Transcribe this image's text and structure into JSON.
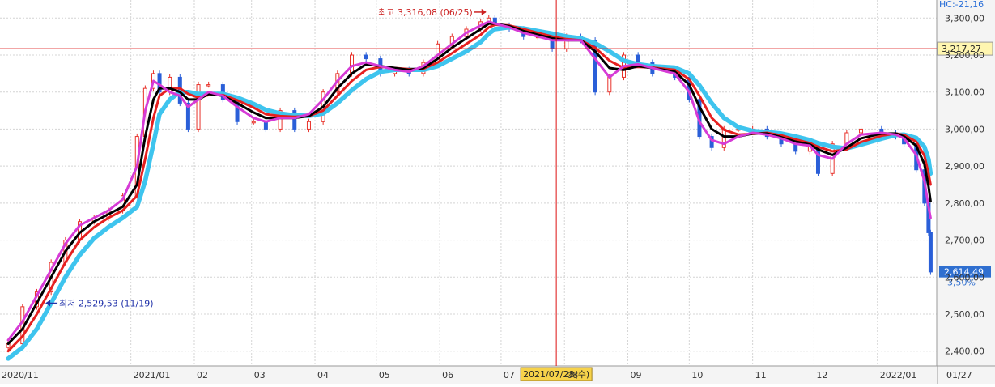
{
  "chart_data": {
    "type": "line",
    "ylim": [
      2360,
      3340
    ],
    "y_ticks": [
      2400,
      2500,
      2600,
      2700,
      2800,
      2900,
      3000,
      3100,
      3200,
      3300
    ],
    "y_tick_labels": [
      "2,400,00",
      "2,500,00",
      "2,600,00",
      "2,700,00",
      "2,800,00",
      "2,900,00",
      "3,000,00",
      "3,100,00",
      "3,200,00",
      "3,300,00"
    ],
    "x_ticks": [
      {
        "label": "2020/11",
        "date": "2020-11-01"
      },
      {
        "label": "2021/01",
        "date": "2021-01-01"
      },
      {
        "label": "02",
        "date": "2021-02-01"
      },
      {
        "label": "03",
        "date": "2021-03-01"
      },
      {
        "label": "04",
        "date": "2021-04-01"
      },
      {
        "label": "05",
        "date": "2021-05-01"
      },
      {
        "label": "06",
        "date": "2021-06-01"
      },
      {
        "label": "07",
        "date": "2021-07-01"
      },
      {
        "label": "08",
        "date": "2021-08-01"
      },
      {
        "label": "09",
        "date": "2021-09-01"
      },
      {
        "label": "10",
        "date": "2021-10-01"
      },
      {
        "label": "11",
        "date": "2021-11-01"
      },
      {
        "label": "12",
        "date": "2021-12-01"
      },
      {
        "label": "2022/01",
        "date": "2022-01-01"
      },
      {
        "label": "01/27",
        "date": "2022-01-27"
      }
    ],
    "crosshair": {
      "date": "2021-07-28",
      "label": "2021/07/28(수)",
      "value": 3217.27,
      "value_label": "3,217,27"
    },
    "last_price": {
      "value": 2614.49,
      "label": "2,614,49",
      "change_label": "-3,50%"
    },
    "header_text": "HC:-21,16",
    "annotations": {
      "high": {
        "text": "최고 3,316,08 (06/25)",
        "date": "2021-06-25",
        "value": 3316.08
      },
      "low": {
        "text": "최저 2,529,53 (11/19)",
        "date": "2020-11-19",
        "value": 2529.53
      }
    },
    "candles": {
      "up_color": "#e8322a",
      "down_color": "#2a5fd8"
    },
    "prices": {
      "x": [
        "2020-11-02",
        "2020-11-09",
        "2020-11-16",
        "2020-11-23",
        "2020-11-30",
        "2020-12-07",
        "2020-12-14",
        "2020-12-21",
        "2020-12-28",
        "2021-01-04",
        "2021-01-08",
        "2021-01-12",
        "2021-01-15",
        "2021-01-20",
        "2021-01-25",
        "2021-01-29",
        "2021-02-03",
        "2021-02-08",
        "2021-02-15",
        "2021-02-22",
        "2021-03-02",
        "2021-03-08",
        "2021-03-15",
        "2021-03-22",
        "2021-03-29",
        "2021-04-05",
        "2021-04-12",
        "2021-04-19",
        "2021-04-26",
        "2021-05-03",
        "2021-05-10",
        "2021-05-17",
        "2021-05-24",
        "2021-05-31",
        "2021-06-07",
        "2021-06-14",
        "2021-06-21",
        "2021-06-25",
        "2021-06-28",
        "2021-07-05",
        "2021-07-12",
        "2021-07-19",
        "2021-07-26",
        "2021-08-02",
        "2021-08-09",
        "2021-08-16",
        "2021-08-23",
        "2021-08-30",
        "2021-09-06",
        "2021-09-13",
        "2021-09-24",
        "2021-10-01",
        "2021-10-06",
        "2021-10-12",
        "2021-10-18",
        "2021-10-25",
        "2021-11-01",
        "2021-11-08",
        "2021-11-15",
        "2021-11-22",
        "2021-11-29",
        "2021-12-03",
        "2021-12-10",
        "2021-12-17",
        "2021-12-24",
        "2022-01-03",
        "2022-01-10",
        "2022-01-14",
        "2022-01-20",
        "2022-01-24",
        "2022-01-26",
        "2022-01-27"
      ],
      "close": [
        2420,
        2520,
        2560,
        2640,
        2700,
        2750,
        2760,
        2780,
        2820,
        2980,
        3110,
        3150,
        3100,
        3140,
        3070,
        3000,
        3120,
        3120,
        3080,
        3020,
        3020,
        3000,
        3050,
        3000,
        3020,
        3100,
        3150,
        3200,
        3190,
        3150,
        3160,
        3150,
        3180,
        3230,
        3250,
        3270,
        3290,
        3300,
        3280,
        3270,
        3250,
        3250,
        3217,
        3250,
        3240,
        3100,
        3140,
        3200,
        3180,
        3150,
        3140,
        3080,
        2980,
        2950,
        3000,
        3000,
        3000,
        2980,
        2960,
        2940,
        2960,
        2880,
        2960,
        2990,
        3000,
        2990,
        2980,
        2960,
        2890,
        2800,
        2720,
        2614
      ]
    },
    "series": [
      {
        "color": "#d63bd6",
        "values": [
          2430,
          2480,
          2550,
          2620,
          2690,
          2740,
          2760,
          2780,
          2810,
          2900,
          3050,
          3130,
          3120,
          3100,
          3090,
          3060,
          3080,
          3100,
          3090,
          3060,
          3030,
          3020,
          3030,
          3030,
          3040,
          3080,
          3130,
          3170,
          3180,
          3170,
          3160,
          3155,
          3170,
          3200,
          3230,
          3260,
          3280,
          3290,
          3285,
          3275,
          3260,
          3250,
          3240,
          3240,
          3240,
          3190,
          3140,
          3170,
          3175,
          3165,
          3150,
          3100,
          3020,
          2970,
          2960,
          2980,
          2990,
          2985,
          2975,
          2960,
          2955,
          2930,
          2920,
          2960,
          2985,
          2990,
          2985,
          2975,
          2930,
          2860,
          2790,
          2760
        ]
      },
      {
        "color": "#000000",
        "values": [
          2420,
          2460,
          2530,
          2600,
          2670,
          2720,
          2750,
          2770,
          2790,
          2850,
          2980,
          3080,
          3110,
          3110,
          3100,
          3080,
          3080,
          3095,
          3090,
          3070,
          3045,
          3030,
          3030,
          3030,
          3035,
          3060,
          3110,
          3150,
          3175,
          3170,
          3165,
          3160,
          3165,
          3190,
          3220,
          3245,
          3270,
          3285,
          3285,
          3278,
          3265,
          3255,
          3245,
          3240,
          3240,
          3210,
          3165,
          3160,
          3170,
          3165,
          3155,
          3120,
          3060,
          3000,
          2980,
          2980,
          2988,
          2988,
          2978,
          2966,
          2958,
          2945,
          2930,
          2950,
          2975,
          2988,
          2988,
          2980,
          2955,
          2905,
          2845,
          2805
        ]
      },
      {
        "color": "#e62020",
        "values": [
          2400,
          2440,
          2500,
          2570,
          2640,
          2700,
          2735,
          2760,
          2780,
          2820,
          2920,
          3030,
          3090,
          3110,
          3110,
          3095,
          3085,
          3092,
          3092,
          3078,
          3058,
          3040,
          3035,
          3033,
          3035,
          3050,
          3090,
          3130,
          3160,
          3168,
          3165,
          3162,
          3163,
          3180,
          3205,
          3230,
          3255,
          3275,
          3282,
          3280,
          3270,
          3260,
          3250,
          3243,
          3240,
          3220,
          3185,
          3165,
          3168,
          3166,
          3160,
          3135,
          3090,
          3030,
          2998,
          2985,
          2987,
          2990,
          2983,
          2972,
          2962,
          2952,
          2940,
          2945,
          2965,
          2982,
          2988,
          2984,
          2966,
          2928,
          2880,
          2850
        ]
      },
      {
        "color": "#3ec4ee",
        "values": [
          2380,
          2410,
          2460,
          2530,
          2600,
          2660,
          2705,
          2735,
          2760,
          2790,
          2860,
          2960,
          3040,
          3080,
          3100,
          3100,
          3095,
          3095,
          3095,
          3085,
          3068,
          3052,
          3042,
          3037,
          3036,
          3042,
          3070,
          3105,
          3135,
          3155,
          3160,
          3160,
          3160,
          3170,
          3190,
          3210,
          3235,
          3258,
          3270,
          3275,
          3272,
          3265,
          3258,
          3250,
          3245,
          3232,
          3210,
          3185,
          3175,
          3170,
          3166,
          3150,
          3118,
          3070,
          3030,
          3005,
          2995,
          2992,
          2988,
          2980,
          2970,
          2962,
          2952,
          2948,
          2958,
          2974,
          2984,
          2985,
          2976,
          2952,
          2918,
          2880
        ]
      }
    ]
  }
}
